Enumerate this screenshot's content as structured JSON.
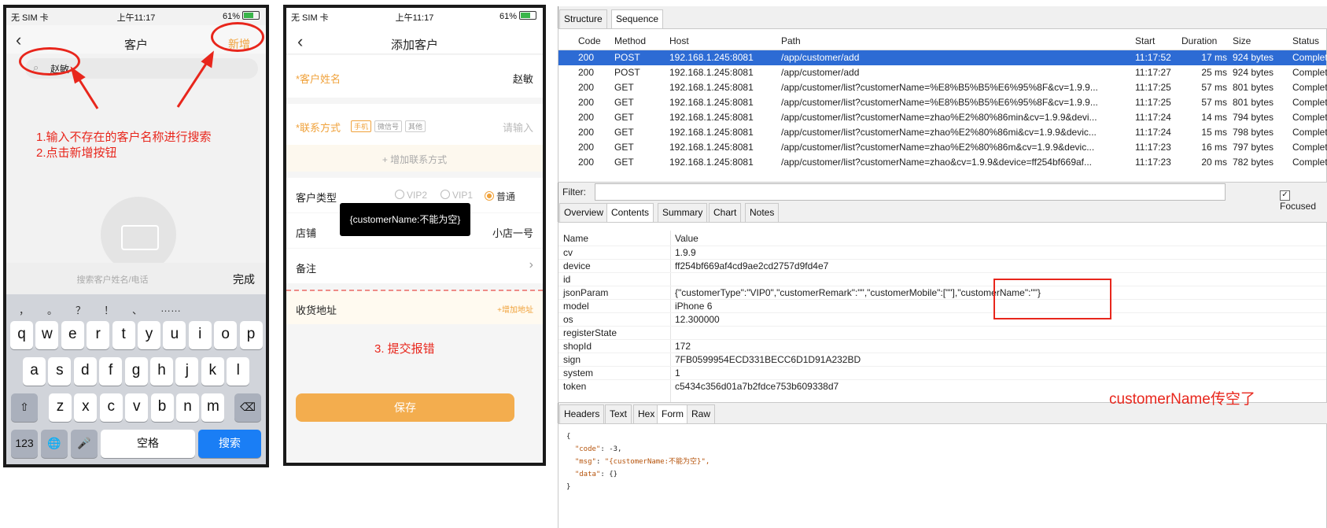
{
  "phone1": {
    "status": {
      "carrier": "无 SIM 卡",
      "time": "上午11:17",
      "battery": "61%"
    },
    "nav": {
      "back": "‹",
      "title": "客户",
      "add": "新增"
    },
    "search": {
      "icon": "search-icon",
      "value": "赵敏"
    },
    "hint_placeholder": "搜索客户姓名/电话",
    "done": "完成",
    "punctuation": [
      "，",
      "。",
      "？",
      "！",
      "、",
      "……"
    ],
    "keys_row1": [
      "q",
      "w",
      "e",
      "r",
      "t",
      "y",
      "u",
      "i",
      "o",
      "p"
    ],
    "keys_row2": [
      "a",
      "s",
      "d",
      "f",
      "g",
      "h",
      "j",
      "k",
      "l"
    ],
    "keys_row3": [
      "z",
      "x",
      "c",
      "v",
      "b",
      "n",
      "m"
    ],
    "key_shift": "⇧",
    "key_delete": "⌫",
    "key_123": "123",
    "key_globe": "🌐",
    "key_mic": "🎤",
    "key_space": "空格",
    "key_search": "搜索"
  },
  "phone2": {
    "status": {
      "carrier": "无 SIM 卡",
      "time": "上午11:17",
      "battery": "61%"
    },
    "nav": {
      "back": "‹",
      "title": "添加客户"
    },
    "name_label": "*客户姓名",
    "name_value": "赵敏",
    "contact_label": "*联系方式",
    "contact_tags": [
      "手机",
      "微信号",
      "其他"
    ],
    "contact_placeholder": "请输入",
    "add_contact": "+ 增加联系方式",
    "type_label": "客户类型",
    "type_options": [
      "VIP2",
      "VIP1",
      "普通"
    ],
    "shop_label": "店铺",
    "shop_value": "小店一号",
    "remark_label": "备注",
    "address_label": "收货地址",
    "address_add": "+增加地址",
    "toast": "{customerName:不能为空}",
    "save": "保存"
  },
  "annotations": {
    "steps_line1": "1.输入不存在的客户名称进行搜索",
    "steps_line2": "2.点击新增按钮",
    "step3": "3. 提交报错",
    "note": "customerName传空了",
    "color": "#e8261c"
  },
  "charles": {
    "top_tabs": [
      "Structure",
      "Sequence"
    ],
    "columns": [
      "Code",
      "Method",
      "Host",
      "Path",
      "Start",
      "Duration",
      "Size",
      "Status"
    ],
    "rows": [
      {
        "code": "200",
        "method": "POST",
        "host": "192.168.1.245:8081",
        "path": "/app/customer/add",
        "start": "11:17:52",
        "duration": "17 ms",
        "size": "924 bytes",
        "status": "Complete"
      },
      {
        "code": "200",
        "method": "POST",
        "host": "192.168.1.245:8081",
        "path": "/app/customer/add",
        "start": "11:17:27",
        "duration": "25 ms",
        "size": "924 bytes",
        "status": "Complete"
      },
      {
        "code": "200",
        "method": "GET",
        "host": "192.168.1.245:8081",
        "path": "/app/customer/list?customerName=%E8%B5%B5%E6%95%8F&cv=1.9.9...",
        "start": "11:17:25",
        "duration": "57 ms",
        "size": "801 bytes",
        "status": "Complete"
      },
      {
        "code": "200",
        "method": "GET",
        "host": "192.168.1.245:8081",
        "path": "/app/customer/list?customerName=%E8%B5%B5%E6%95%8F&cv=1.9.9...",
        "start": "11:17:25",
        "duration": "57 ms",
        "size": "801 bytes",
        "status": "Complete"
      },
      {
        "code": "200",
        "method": "GET",
        "host": "192.168.1.245:8081",
        "path": "/app/customer/list?customerName=zhao%E2%80%86min&cv=1.9.9&devi...",
        "start": "11:17:24",
        "duration": "14 ms",
        "size": "794 bytes",
        "status": "Complete"
      },
      {
        "code": "200",
        "method": "GET",
        "host": "192.168.1.245:8081",
        "path": "/app/customer/list?customerName=zhao%E2%80%86mi&cv=1.9.9&devic...",
        "start": "11:17:24",
        "duration": "15 ms",
        "size": "798 bytes",
        "status": "Complete"
      },
      {
        "code": "200",
        "method": "GET",
        "host": "192.168.1.245:8081",
        "path": "/app/customer/list?customerName=zhao%E2%80%86m&cv=1.9.9&devic...",
        "start": "11:17:23",
        "duration": "16 ms",
        "size": "797 bytes",
        "status": "Complete"
      },
      {
        "code": "200",
        "method": "GET",
        "host": "192.168.1.245:8081",
        "path": "/app/customer/list?customerName=zhao&cv=1.9.9&device=ff254bf669af...",
        "start": "11:17:23",
        "duration": "20 ms",
        "size": "782 bytes",
        "status": "Complete"
      }
    ],
    "filter_label": "Filter:",
    "focused_label": "Focused",
    "detail_tabs": [
      "Overview",
      "Contents",
      "Summary",
      "Chart",
      "Notes"
    ],
    "kv_header": {
      "name": "Name",
      "value": "Value"
    },
    "kv": [
      {
        "k": "cv",
        "v": "1.9.9"
      },
      {
        "k": "device",
        "v": "ff254bf669af4cd9ae2cd2757d9fd4e7"
      },
      {
        "k": "id",
        "v": ""
      },
      {
        "k": "jsonParam",
        "v": "{\"customerType\":\"VIP0\",\"customerRemark\":\"\",\"customerMobile\":[\"\"],\"customerName\":\"\"}"
      },
      {
        "k": "model",
        "v": "iPhone 6"
      },
      {
        "k": "os",
        "v": "12.300000"
      },
      {
        "k": "registerState",
        "v": ""
      },
      {
        "k": "shopId",
        "v": "172"
      },
      {
        "k": "sign",
        "v": "7FB0599954ECD331BECC6D1D91A232BD"
      },
      {
        "k": "system",
        "v": "1"
      },
      {
        "k": "token",
        "v": "c5434c356d01a7b2fdce753b609338d7"
      }
    ],
    "bottom_tabs": [
      "Headers",
      "Text",
      "Hex",
      "Form",
      "Raw"
    ],
    "response": {
      "open": "{",
      "code_key": "\"code\"",
      "code_val": "-3,",
      "msg_key": "\"msg\"",
      "msg_val": "\"{customerName:不能为空}\",",
      "data_key": "\"data\"",
      "data_val": "{}",
      "close": "}"
    }
  }
}
